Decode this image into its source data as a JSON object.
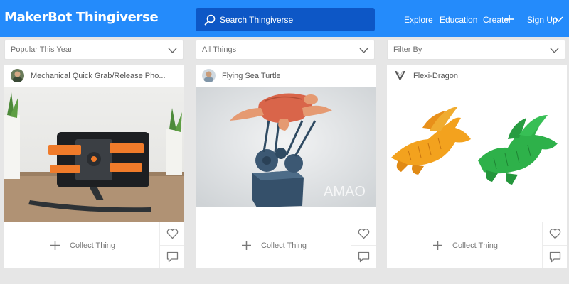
{
  "header": {
    "logo": "MakerBot Thingiverse",
    "search_placeholder": "Search Thingiverse",
    "nav": {
      "explore": "Explore",
      "education": "Education",
      "create": "Create",
      "signup": "Sign Up"
    }
  },
  "filters": [
    {
      "label": "Popular This Year"
    },
    {
      "label": "All Things"
    },
    {
      "label": "Filter By"
    }
  ],
  "cards": [
    {
      "title": "Mechanical Quick Grab/Release Pho...",
      "collect_label": "Collect Thing"
    },
    {
      "title": "Flying Sea Turtle",
      "collect_label": "Collect Thing"
    },
    {
      "title": "Flexi-Dragon",
      "collect_label": "Collect Thing"
    }
  ],
  "watermark": "AMAO",
  "colors": {
    "header_bg": "#248bfb",
    "search_bg": "#0d57c6",
    "page_bg": "#e6e6e6"
  }
}
